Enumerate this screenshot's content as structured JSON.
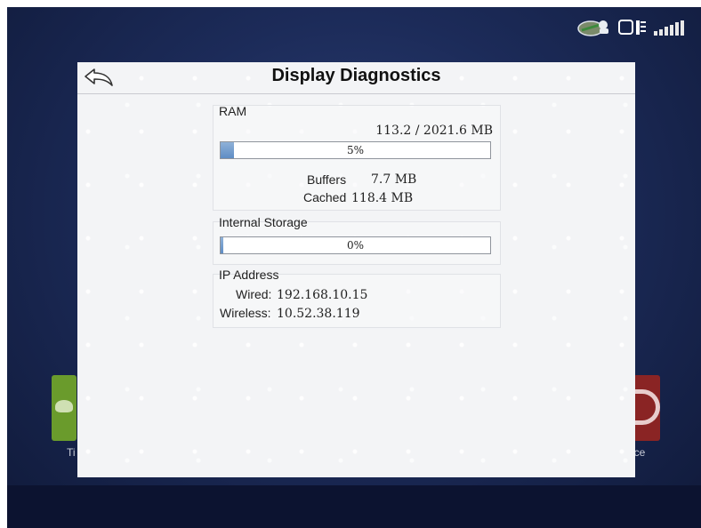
{
  "dialog": {
    "title": "Display Diagnostics"
  },
  "ram": {
    "label": "RAM",
    "usage": "113.2 / 2021.6 MB",
    "percent_text": "5%",
    "percent": 5,
    "buffers_label": "Buffers",
    "buffers_value": "7.7 MB",
    "cached_label": "Cached",
    "cached_value": "118.4 MB"
  },
  "storage": {
    "label": "Internal Storage",
    "percent_text": "0%",
    "percent": 0
  },
  "ip": {
    "label": "IP Address",
    "wired_label": "Wired:",
    "wired_value": "192.168.10.15",
    "wireless_label": "Wireless:",
    "wireless_value": "10.52.38.119"
  },
  "background_tiles": {
    "left_label": "Ti",
    "right_label": "nce"
  },
  "icons": {
    "back": "back-arrow-icon",
    "status": [
      "field-connect-icon",
      "display-module-icon",
      "signal-strength-icon"
    ]
  },
  "colors": {
    "progress_fill": "#5f8dc4",
    "background": "#1c2b59",
    "left_tile": "#6a9b2c",
    "right_tile": "#8a2424"
  }
}
